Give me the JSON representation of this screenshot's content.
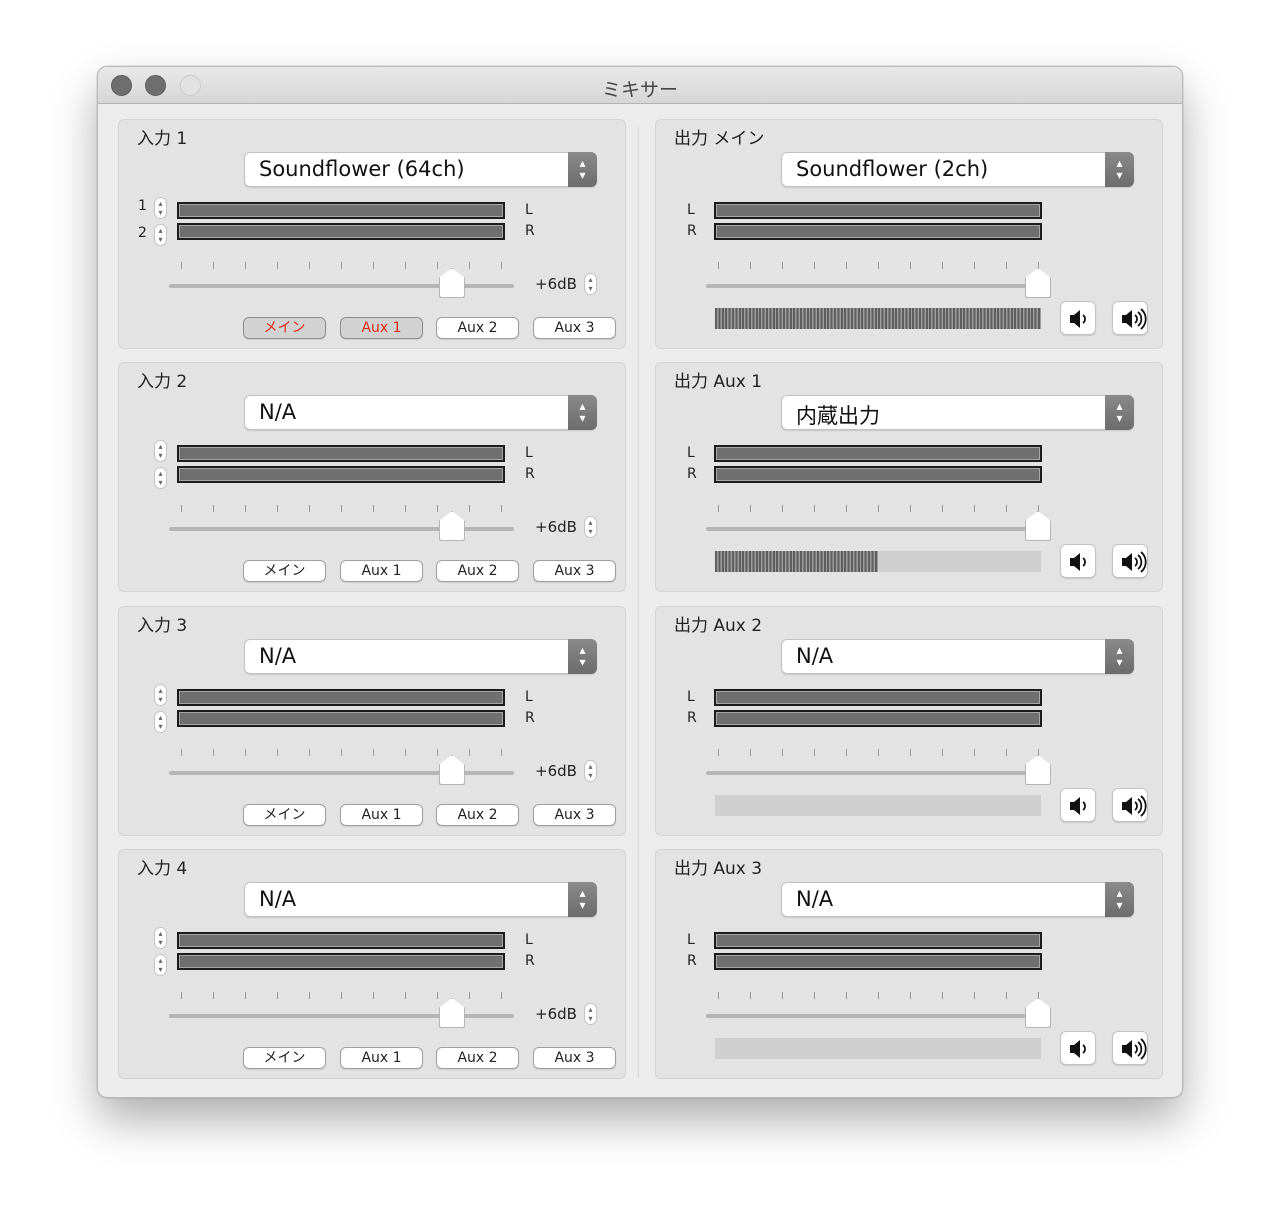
{
  "window": {
    "title": "ミキサー"
  },
  "inputs": [
    {
      "title": "入力 1",
      "device": "Soundflower (64ch)",
      "channel_1": "1",
      "channel_2": "2",
      "gain": "+6dB",
      "routes": [
        {
          "label": "メイン",
          "active": true
        },
        {
          "label": "Aux 1",
          "active": true
        },
        {
          "label": "Aux 2",
          "active": false
        },
        {
          "label": "Aux 3",
          "active": false
        }
      ]
    },
    {
      "title": "入力 2",
      "device": "N/A",
      "channel_1": "",
      "channel_2": "",
      "gain": "+6dB",
      "routes": [
        {
          "label": "メイン",
          "active": false
        },
        {
          "label": "Aux 1",
          "active": false
        },
        {
          "label": "Aux 2",
          "active": false
        },
        {
          "label": "Aux 3",
          "active": false
        }
      ]
    },
    {
      "title": "入力 3",
      "device": "N/A",
      "channel_1": "",
      "channel_2": "",
      "gain": "+6dB",
      "routes": [
        {
          "label": "メイン",
          "active": false
        },
        {
          "label": "Aux 1",
          "active": false
        },
        {
          "label": "Aux 2",
          "active": false
        },
        {
          "label": "Aux 3",
          "active": false
        }
      ]
    },
    {
      "title": "入力 4",
      "device": "N/A",
      "channel_1": "",
      "channel_2": "",
      "gain": "+6dB",
      "routes": [
        {
          "label": "メイン",
          "active": false
        },
        {
          "label": "Aux 1",
          "active": false
        },
        {
          "label": "Aux 2",
          "active": false
        },
        {
          "label": "Aux 3",
          "active": false
        }
      ]
    }
  ],
  "outputs": [
    {
      "title": "出力 メイン",
      "device": "Soundflower (2ch)",
      "level": 1.0
    },
    {
      "title": "出力 Aux 1",
      "device": "内蔵出力",
      "level": 0.5
    },
    {
      "title": "出力 Aux 2",
      "device": "N/A",
      "level": 0.0
    },
    {
      "title": "出力 Aux 3",
      "device": "N/A",
      "level": 0.0
    }
  ],
  "labels": {
    "left": "L",
    "right": "R"
  },
  "slider": {
    "input_value": 0.82,
    "output_value": 1.0
  },
  "colors": {
    "active_route_text": "#e0291c",
    "meter_fill": "#6f6f6f"
  },
  "icons": {
    "volume_down": "speaker-low-icon",
    "volume_up": "speaker-high-icon"
  }
}
